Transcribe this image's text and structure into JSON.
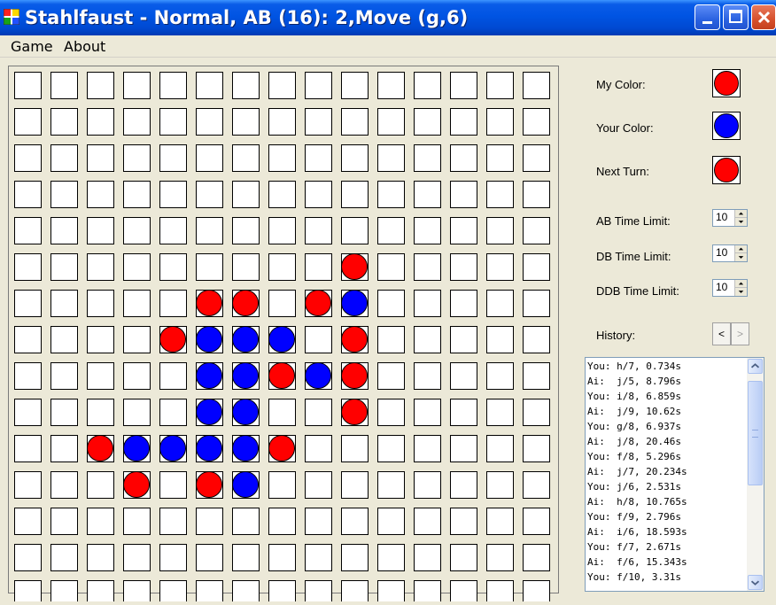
{
  "window": {
    "title": "Stahlfaust - Normal, AB (16): 2,Move (g,6)"
  },
  "menu": [
    {
      "label": "Game"
    },
    {
      "label": "About"
    }
  ],
  "board": {
    "rows": 15,
    "cols": 15,
    "stones": [
      {
        "row": 5,
        "col": 9,
        "color": "red"
      },
      {
        "row": 6,
        "col": 5,
        "color": "red"
      },
      {
        "row": 6,
        "col": 6,
        "color": "red"
      },
      {
        "row": 6,
        "col": 8,
        "color": "red"
      },
      {
        "row": 6,
        "col": 9,
        "color": "blue"
      },
      {
        "row": 7,
        "col": 4,
        "color": "red"
      },
      {
        "row": 7,
        "col": 5,
        "color": "blue"
      },
      {
        "row": 7,
        "col": 6,
        "color": "blue"
      },
      {
        "row": 7,
        "col": 7,
        "color": "blue"
      },
      {
        "row": 7,
        "col": 9,
        "color": "red"
      },
      {
        "row": 8,
        "col": 5,
        "color": "blue"
      },
      {
        "row": 8,
        "col": 6,
        "color": "blue"
      },
      {
        "row": 8,
        "col": 7,
        "color": "red"
      },
      {
        "row": 8,
        "col": 8,
        "color": "blue"
      },
      {
        "row": 8,
        "col": 9,
        "color": "red"
      },
      {
        "row": 9,
        "col": 5,
        "color": "blue"
      },
      {
        "row": 9,
        "col": 6,
        "color": "blue"
      },
      {
        "row": 9,
        "col": 9,
        "color": "red"
      },
      {
        "row": 10,
        "col": 2,
        "color": "red"
      },
      {
        "row": 10,
        "col": 3,
        "color": "blue"
      },
      {
        "row": 10,
        "col": 4,
        "color": "blue"
      },
      {
        "row": 10,
        "col": 5,
        "color": "blue"
      },
      {
        "row": 10,
        "col": 6,
        "color": "blue"
      },
      {
        "row": 10,
        "col": 7,
        "color": "red"
      },
      {
        "row": 11,
        "col": 3,
        "color": "red"
      },
      {
        "row": 11,
        "col": 5,
        "color": "red"
      },
      {
        "row": 11,
        "col": 6,
        "color": "blue"
      }
    ]
  },
  "colors": {
    "red": "#ff0000",
    "blue": "#0000ff",
    "titlebar": "#0054e3"
  },
  "panel": {
    "my_color_label": "My Color:",
    "my_color": "#ff0000",
    "your_color_label": "Your Color:",
    "your_color": "#0000ff",
    "next_turn_label": "Next Turn:",
    "next_turn_color": "#ff0000",
    "ab_label": "AB Time Limit:",
    "ab_value": "10",
    "db_label": "DB Time Limit:",
    "db_value": "10",
    "ddb_label": "DDB Time Limit:",
    "ddb_value": "10",
    "history_label": "History:",
    "hist_prev": "<",
    "hist_next": ">"
  },
  "history": [
    "You: h/7, 0.734s",
    "Ai:  j/5, 8.796s",
    "You: i/8, 6.859s",
    "Ai:  j/9, 10.62s",
    "You: g/8, 6.937s",
    "Ai:  j/8, 20.46s",
    "You: f/8, 5.296s",
    "Ai:  j/7, 20.234s",
    "You: j/6, 2.531s",
    "Ai:  h/8, 10.765s",
    "You: f/9, 2.796s",
    "Ai:  i/6, 18.593s",
    "You: f/7, 2.671s",
    "Ai:  f/6, 15.343s",
    "You: f/10, 3.31s"
  ]
}
